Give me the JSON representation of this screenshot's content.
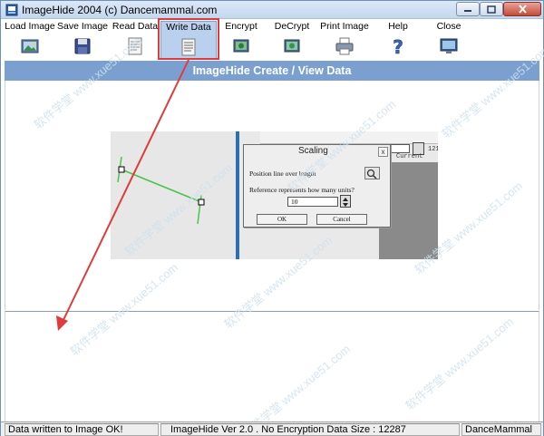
{
  "window": {
    "title": "ImageHide 2004 (c) Dancemammal.com",
    "controls": {
      "minimize": "—",
      "maximize": "□",
      "close": "✕"
    }
  },
  "toolbar": {
    "items": [
      {
        "label": "Load Image",
        "icon": "load-image-icon"
      },
      {
        "label": "Save Image",
        "icon": "save-image-icon"
      },
      {
        "label": "Read Data",
        "icon": "read-data-icon"
      },
      {
        "label": "Write Data",
        "icon": "write-data-icon",
        "active": true
      },
      {
        "label": "Encrypt",
        "icon": "encrypt-icon"
      },
      {
        "label": "DeCrypt",
        "icon": "decrypt-icon"
      },
      {
        "label": "Print Image",
        "icon": "print-image-icon"
      },
      {
        "label": "Help",
        "icon": "help-icon"
      },
      {
        "label": "Close",
        "icon": "close-icon"
      }
    ]
  },
  "header": {
    "title": "ImageHide Create / View Data"
  },
  "embedded_image": {
    "dialog": {
      "title": "Scaling",
      "line1": "Position line over length",
      "line2": "Reference represents how many units?",
      "value": "10",
      "ok_label": "OK",
      "cancel_label": "Cancel",
      "close_glyph": "x"
    },
    "current_label": "Current",
    "field_value": "1",
    "side_value": "121"
  },
  "watermark": "软件学堂 www.xue51.com",
  "colors": {
    "header_band": "#7ba0d0",
    "annotation": "#e03a3a",
    "active_tool": "#b9d1ee"
  },
  "status": {
    "left": "Data written to Image OK!",
    "middle": "ImageHide Ver 2.0 . No Encryption Data Size : 12287",
    "right": "DanceMammal"
  }
}
